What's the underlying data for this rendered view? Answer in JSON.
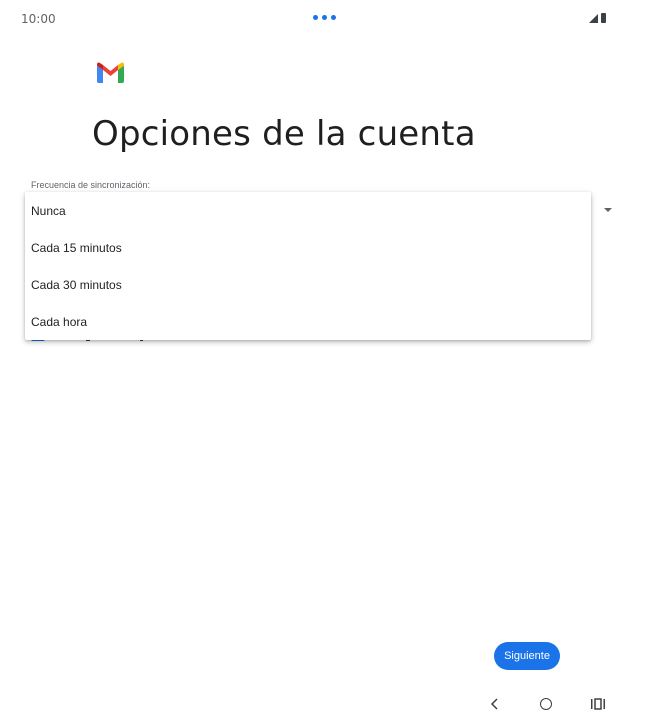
{
  "status_bar": {
    "time": "10:00"
  },
  "page": {
    "title": "Opciones de la cuenta",
    "sync_label": "Frecuencia de sincronización:"
  },
  "dropdown": {
    "options": [
      "Nunca",
      "Cada 15 minutos",
      "Cada 30 minutos",
      "Cada hora"
    ]
  },
  "buttons": {
    "next_label": "Siguiente"
  },
  "icons": {
    "logo": "gmail-logo",
    "nav_back": "back-icon",
    "nav_home": "home-icon",
    "nav_recents": "recents-icon"
  },
  "colors": {
    "accent": "#1a73e8",
    "text": "#1f1f1f",
    "muted": "#5f6368"
  }
}
